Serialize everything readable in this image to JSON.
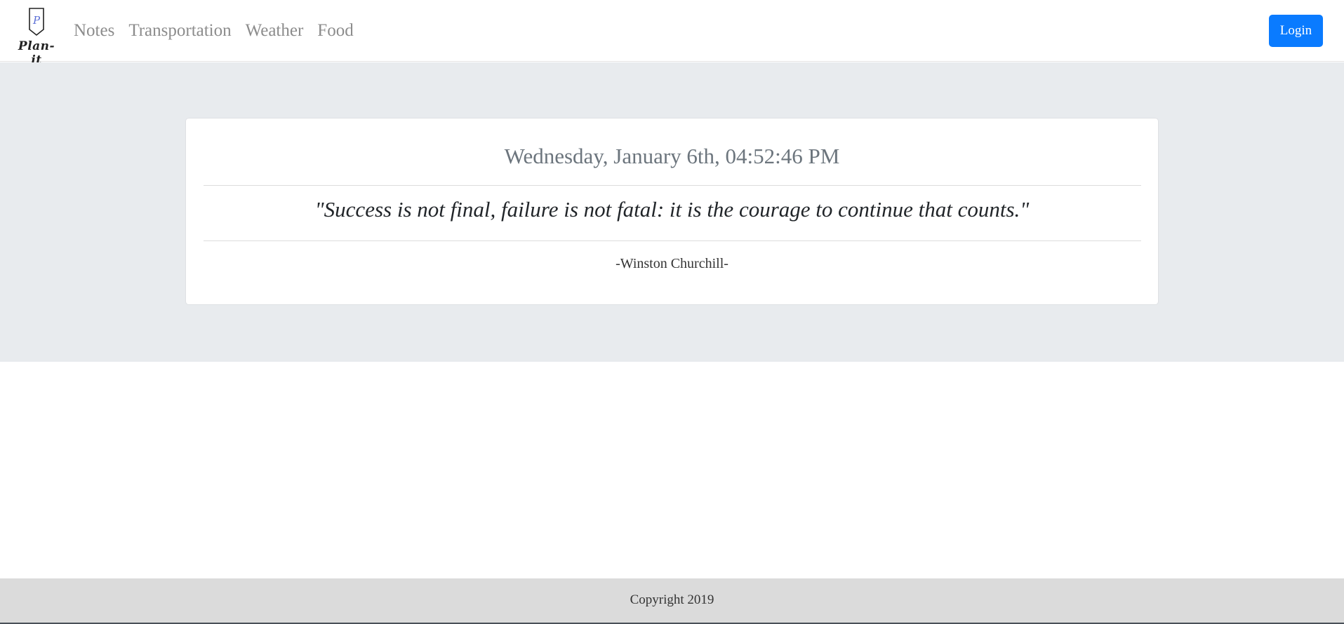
{
  "brand": {
    "name": "Plan-it",
    "logo_icon": "flag-p-icon"
  },
  "nav": {
    "items": [
      {
        "label": "Notes"
      },
      {
        "label": "Transportation"
      },
      {
        "label": "Weather"
      },
      {
        "label": "Food"
      }
    ],
    "login_label": "Login"
  },
  "hero": {
    "datetime": "Wednesday, January 6th, 04:52:46 PM",
    "quote": "\"Success is not final, failure is not fatal: it is the courage to continue that counts.\"",
    "author": "-Winston Churchill-"
  },
  "footer": {
    "copyright": "Copyright 2019"
  },
  "colors": {
    "accent": "#0a7bff",
    "hero_bg": "#e8ebee",
    "footer_bg": "#dbdbdb",
    "nav_text": "#8c8c8c"
  }
}
